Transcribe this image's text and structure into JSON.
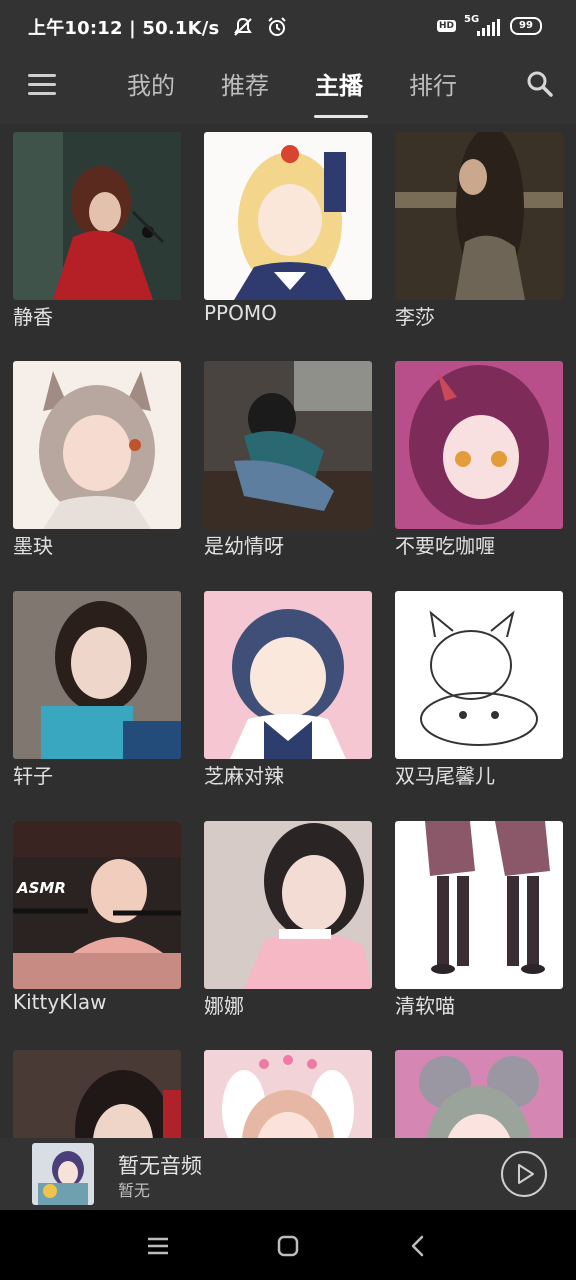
{
  "status": {
    "time": "上午10:12",
    "speed": "50.1K/s",
    "hd": "HD",
    "network": "5G",
    "battery": "99"
  },
  "nav": {
    "tabs": [
      {
        "label": "我的"
      },
      {
        "label": "推荐"
      },
      {
        "label": "主播"
      },
      {
        "label": "排行"
      }
    ],
    "active_tab": "主播"
  },
  "anchors": [
    {
      "name": "静香"
    },
    {
      "name": "PPOMO"
    },
    {
      "name": "李莎"
    },
    {
      "name": "墨玦"
    },
    {
      "name": "是幼情呀"
    },
    {
      "name": "不要吃咖喱"
    },
    {
      "name": "轩子"
    },
    {
      "name": "芝麻对辣"
    },
    {
      "name": "双马尾馨儿"
    },
    {
      "name": "KittyKlaw"
    },
    {
      "name": "娜娜"
    },
    {
      "name": "清软喵"
    },
    {
      "name": ""
    },
    {
      "name": ""
    },
    {
      "name": ""
    }
  ],
  "player": {
    "title": "暂无音频",
    "subtitle": "暂无"
  },
  "colors": {
    "background": "#2f2f2f",
    "bar": "#333333",
    "text": "#e0e0e0",
    "navbar": "#000000"
  }
}
